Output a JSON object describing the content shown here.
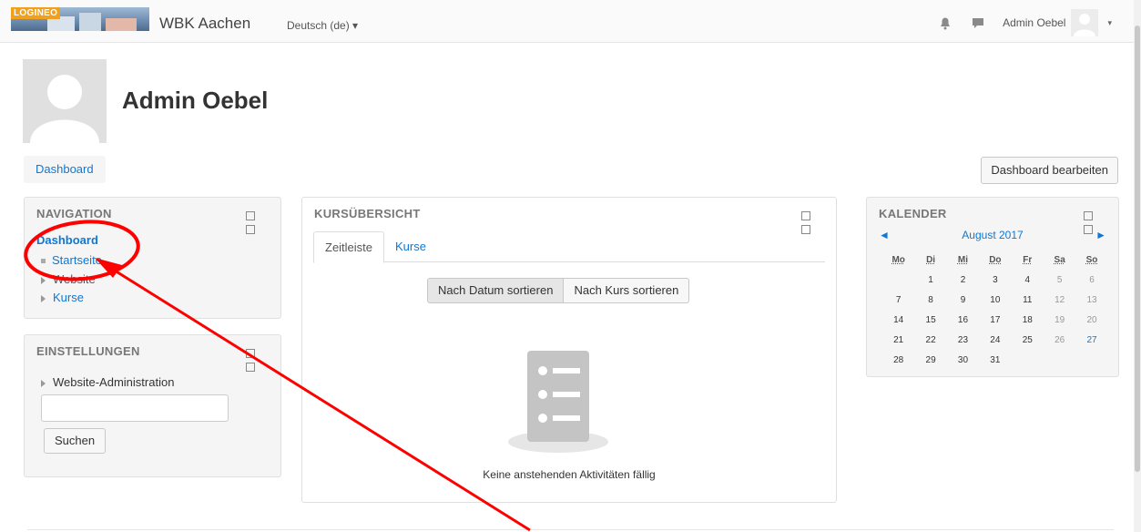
{
  "header": {
    "logo_text": "LOGINEO",
    "site_name": "WBK Aachen",
    "language": "Deutsch (de) ▾",
    "user_name": "Admin Oebel",
    "caret": "▾"
  },
  "page": {
    "title": "Admin Oebel",
    "breadcrumb": "Dashboard",
    "edit_button": "Dashboard bearbeiten"
  },
  "navigation": {
    "title": "NAVIGATION",
    "dashboard": "Dashboard",
    "items": [
      "Startseite",
      "Website",
      "Kurse"
    ]
  },
  "settings": {
    "title": "EINSTELLUNGEN",
    "item": "Website-Administration",
    "search_value": "",
    "search_button": "Suchen"
  },
  "course_overview": {
    "title": "KURSÜBERSICHT",
    "tabs": [
      "Zeitleiste",
      "Kurse"
    ],
    "sort_by_date": "Nach Datum sortieren",
    "sort_by_course": "Nach Kurs sortieren",
    "empty_message": "Keine anstehenden Aktivitäten fällig"
  },
  "calendar": {
    "title": "KALENDER",
    "month": "August 2017",
    "prev": "◄",
    "next": "►",
    "weekdays": [
      "Mo",
      "Di",
      "Mi",
      "Do",
      "Fr",
      "Sa",
      "So"
    ],
    "weeks": [
      [
        "",
        "1",
        "2",
        "3",
        "4",
        "5",
        "6"
      ],
      [
        "7",
        "8",
        "9",
        "10",
        "11",
        "12",
        "13"
      ],
      [
        "14",
        "15",
        "16",
        "17",
        "18",
        "19",
        "20"
      ],
      [
        "21",
        "22",
        "23",
        "24",
        "25",
        "26",
        "27"
      ],
      [
        "28",
        "29",
        "30",
        "31",
        "",
        "",
        ""
      ]
    ],
    "today": "27"
  },
  "colors": {
    "link": "#1177d1",
    "annotation": "#ff0000",
    "logo_orange": "#f0a01c"
  }
}
